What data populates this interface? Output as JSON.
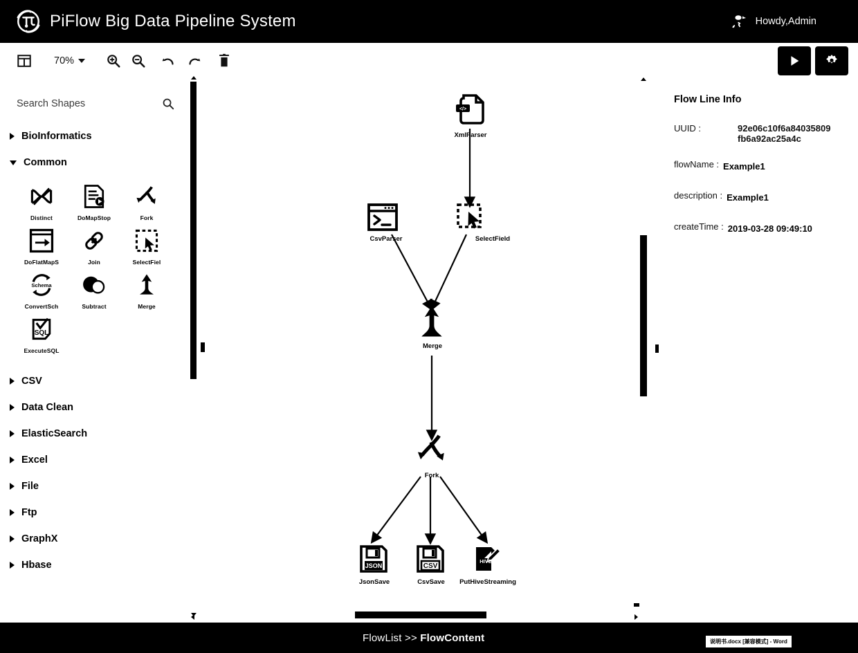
{
  "header": {
    "title": "PiFlow Big Data Pipeline System",
    "logo_icon": "pi-circle-logo-icon",
    "user_icon": "user-avatar-icon",
    "user_greeting": "Howdy,Admin"
  },
  "toolbar": {
    "layout_icon": "panel-layout-icon",
    "zoom_level": "70%",
    "zoom_in_icon": "zoom-in-icon",
    "zoom_out_icon": "zoom-out-icon",
    "undo_icon": "undo-icon",
    "redo_icon": "redo-icon",
    "delete_icon": "trash-icon",
    "run_icon": "play-icon",
    "settings_icon": "gear-icon"
  },
  "shapes_panel": {
    "search_placeholder": "Search Shapes",
    "search_value": "",
    "search_icon": "search-icon",
    "categories": [
      {
        "label": "BioInformatics",
        "expanded": false
      },
      {
        "label": "Common",
        "expanded": true
      },
      {
        "label": "CSV",
        "expanded": false
      },
      {
        "label": "Data Clean",
        "expanded": false
      },
      {
        "label": "ElasticSearch",
        "expanded": false
      },
      {
        "label": "Excel",
        "expanded": false
      },
      {
        "label": "File",
        "expanded": false
      },
      {
        "label": "Ftp",
        "expanded": false
      },
      {
        "label": "GraphX",
        "expanded": false
      },
      {
        "label": "Hbase",
        "expanded": false
      }
    ],
    "common_shapes": [
      {
        "label": "Distinct",
        "icon": "distinct-icon"
      },
      {
        "label": "DoMapStop",
        "icon": "do-map-stop-icon"
      },
      {
        "label": "Fork",
        "icon": "fork-icon"
      },
      {
        "label": "DoFlatMapS",
        "icon": "do-flat-map-icon"
      },
      {
        "label": "Join",
        "icon": "join-link-icon"
      },
      {
        "label": "SelectFiel",
        "icon": "select-field-icon"
      },
      {
        "label": "ConvertSch",
        "icon": "convert-schema-icon"
      },
      {
        "label": "Subtract",
        "icon": "subtract-icon"
      },
      {
        "label": "Merge",
        "icon": "merge-icon"
      },
      {
        "label": "ExecuteSQL",
        "icon": "execute-sql-icon"
      }
    ]
  },
  "canvas": {
    "nodes": [
      {
        "label": "XmlParser",
        "icon": "xml-document-icon"
      },
      {
        "label": "CsvParser",
        "icon": "terminal-icon"
      },
      {
        "label": "SelectField",
        "icon": "select-field-icon"
      },
      {
        "label": "Merge",
        "icon": "merge-icon"
      },
      {
        "label": "Fork",
        "icon": "fork-icon"
      },
      {
        "label": "JsonSave",
        "icon": "json-floppy-icon"
      },
      {
        "label": "CsvSave",
        "icon": "csv-floppy-icon"
      },
      {
        "label": "PutHiveStreaming",
        "icon": "hive-document-icon"
      }
    ]
  },
  "info_panel": {
    "title": "Flow Line Info",
    "uuid_label": "UUID :",
    "uuid_value_line1": "92e06c10f6a84035809",
    "uuid_value_line2": "fb6a92ac25a4c",
    "flow_name_label": "flowName :",
    "flow_name_value": "Example1",
    "description_label": "description :",
    "description_value": "Example1",
    "create_time_label": "createTime :",
    "create_time_value": "2019-03-28 09:49:10"
  },
  "status_bar": {
    "breadcrumb_parent": "FlowList >> ",
    "breadcrumb_current": "FlowContent",
    "taskbar_item": "说明书.docx [兼容模式] - Word"
  },
  "colors": {
    "chrome": "#000000",
    "surface": "#ffffff",
    "text": "#111111"
  }
}
